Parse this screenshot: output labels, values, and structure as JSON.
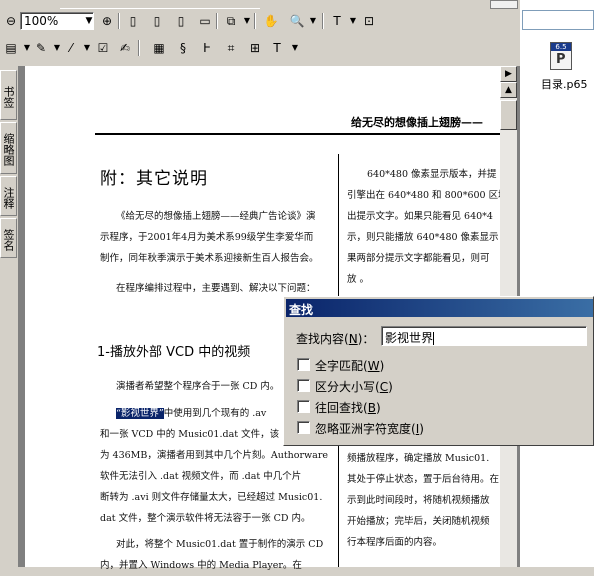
{
  "toolbar": {
    "zoom_value": "100%"
  },
  "side_tabs": [
    "书签",
    "缩略图",
    "注释",
    "签名"
  ],
  "right_pane": {
    "file_name": "目录.p65",
    "file_badge": "6.5",
    "file_letter": "P"
  },
  "document": {
    "header": "给无尽的想像插上翅膀——",
    "title": "附：其它说明",
    "para1_l1": "《给无尽的想像插上翅膀——经典广告论谈》演",
    "para1_l2": "示程序，于2001年4月为美术系99级学生李爱华而",
    "para1_l3": "制作，同年秋季演示于美术系迎接新生百人报告会。",
    "para2": "在程序编排过程中，主要遇到、解决以下问题：",
    "section_heading": "1-播放外部 VCD 中的视频",
    "para3": "演播者希望整个程序合于一张 CD 内。",
    "para4_highlight": "“影视世界”",
    "para4_rest": "中使用到几个现有的 .av",
    "para4_l2": "和一张 VCD 中的 Music01.dat 文件，该",
    "para4_l3": "为 436MB，演播者用到其中几个片刻。Authorware",
    "para4_l4": "软件无法引入 .dat 视频文件，而 .dat 中几个片",
    "para4_l5": "断转为 .avi 则文件存储量太大，已经超过 Music01.",
    "para4_l6": "dat 文件，整个演示软件将无法容于一张 CD 内。",
    "para5_l1": "对此，将整个 Music01.dat 置于制作的演示 CD",
    "para5_l2": "内，并置入 Windows 中的 Media Player。在",
    "right_col_l1": "640*480 像素显示版本，并提",
    "right_col_l2": "引擎出在 640*480 和 800*600 区域",
    "right_col_l3": "出提示文字。如果只能看见 640*4",
    "right_col_l4": "示，则只能播放 640*480 像素显示",
    "right_col_l5": "果两部分提示文字都能看见，则可",
    "right_col_l6": "放 。",
    "right_bottom_l1": "频播放程序，确定播放 Music01.",
    "right_bottom_l2": "其处于停止状态，置于后台待用。在",
    "right_bottom_l3": "示到此时间段时，将随机视频播放",
    "right_bottom_l4": "开始播放；完毕后，关闭随机视频",
    "right_bottom_l5": "行本程序后面的内容。"
  },
  "find_dialog": {
    "title": "查找",
    "label": "查找内容",
    "label_key": "N",
    "input_value": "影视世界",
    "options": [
      {
        "text": "全字匹配",
        "key": "W"
      },
      {
        "text": "区分大小写",
        "key": "C"
      },
      {
        "text": "往回查找",
        "key": "B"
      },
      {
        "text": "忽略亚洲字符宽度",
        "key": "I"
      }
    ]
  }
}
